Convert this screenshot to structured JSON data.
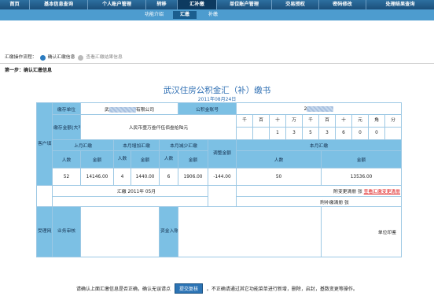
{
  "nav": {
    "items": [
      {
        "label": "首页"
      },
      {
        "label": "基本信息查询"
      },
      {
        "label": "个人账户管理"
      },
      {
        "label": "转移"
      },
      {
        "label": "汇补缴"
      },
      {
        "label": "单位账户管理"
      },
      {
        "label": "交易授权"
      },
      {
        "label": "密码修改"
      },
      {
        "label": "处理结果查询"
      }
    ],
    "sub": [
      {
        "label": "功能介绍"
      },
      {
        "label": "汇缴"
      },
      {
        "label": "补缴"
      }
    ]
  },
  "steps": {
    "prefix": "汇缴操作流程：",
    "step1": "确认汇缴信息",
    "step2": "查看汇缴结果信息"
  },
  "section_title": "第一步：确认汇缴信息",
  "form": {
    "title": "武汉住房公积金汇（补）缴书",
    "date": "2011年08月24日",
    "side_client": "客户填写",
    "side_bank": "受理网点填写",
    "unit_name_label": "缴存单位",
    "unit_name_prefix": "武",
    "unit_name_suffix": "有限公司",
    "account_label": "公积金账号",
    "account_prefix": "2",
    "amount_label": "缴存金额(大写)",
    "amount_upper": "人民币壹万叁仟伍佰叁拾陆元",
    "digit_headers": [
      "千",
      "百",
      "十",
      "万",
      "千",
      "百",
      "十",
      "元",
      "角",
      "分"
    ],
    "digits": [
      "",
      "",
      "1",
      "3",
      "5",
      "3",
      "6",
      "0",
      "0"
    ],
    "last_month": "上月汇缴",
    "inc": "本月增加汇缴",
    "dec": "本月减少汇缴",
    "adjust": "调整金额",
    "this_month": "本月汇缴",
    "persons": "人数",
    "amount": "金额",
    "v_last_p": "52",
    "v_last_a": "14146.00",
    "v_inc_p": "4",
    "v_inc_a": "1440.00",
    "v_dec_p": "6",
    "v_dec_a": "1906.00",
    "v_adj": "-144.00",
    "v_this_p": "50",
    "v_this_a": "13536.00",
    "period_label": "汇缴",
    "period_year": "2011年",
    "period_month": "05月",
    "attach_change": "附变更清册",
    "attach_unit": "张",
    "view_change": "查看汇缴变更清册",
    "attach_payment": "附补缴清册",
    "attach_payment_unit": "张",
    "biz_review": "业务审核",
    "fund_in": "资金入账",
    "unit_seal": "单位印鉴"
  },
  "footer": {
    "before": "请确认上面汇缴信息是否正确，确认无误请点",
    "button": "提交复核",
    "after": "。不正确请通过其它功能菜单进行新增，删除，启封，基数变更等操作。"
  }
}
